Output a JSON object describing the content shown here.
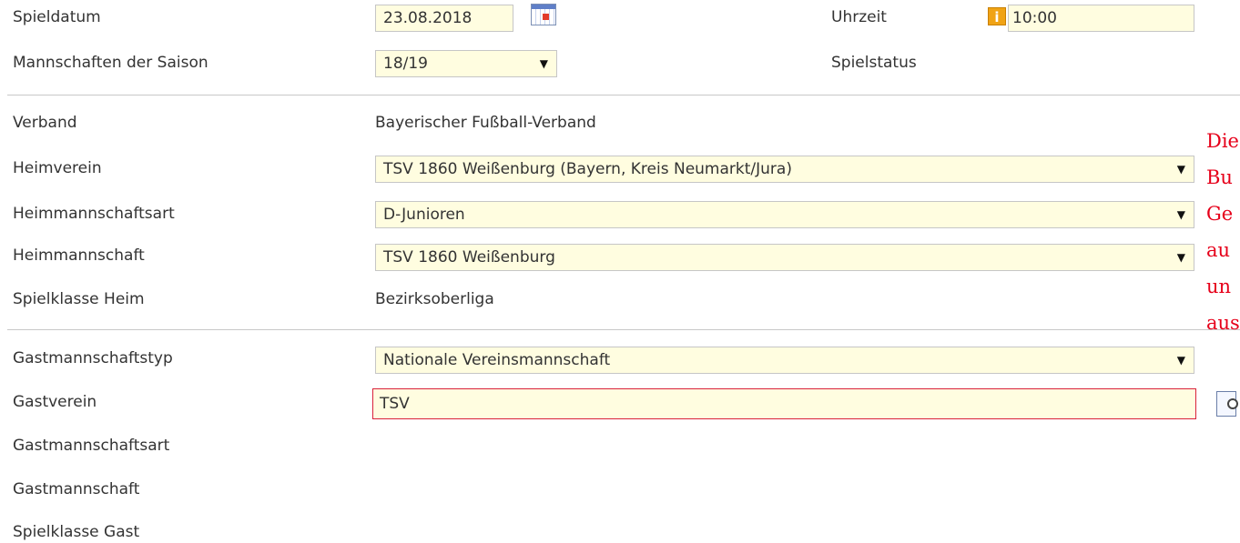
{
  "rows": {
    "spieldatum": {
      "label": "Spieldatum",
      "value": "23.08.2018"
    },
    "uhrzeit": {
      "label": "Uhrzeit",
      "value": "10:00",
      "info_glyph": "i"
    },
    "saison": {
      "label": "Mannschaften der Saison",
      "value": "18/19"
    },
    "spielstatus": {
      "label": "Spielstatus"
    },
    "verband": {
      "label": "Verband",
      "value": "Bayerischer Fußball-Verband"
    },
    "heimverein": {
      "label": "Heimverein",
      "value": "TSV 1860 Weißenburg (Bayern, Kreis Neumarkt/Jura)"
    },
    "heimmannschaftsart": {
      "label": "Heimmannschaftsart",
      "value": "D-Junioren"
    },
    "heimmannschaft": {
      "label": "Heimmannschaft",
      "value": "TSV 1860 Weißenburg"
    },
    "spielklasse_heim": {
      "label": "Spielklasse Heim",
      "value": "Bezirksoberliga"
    },
    "gastmannschaftstyp": {
      "label": "Gastmannschaftstyp",
      "value": "Nationale Vereinsmannschaft"
    },
    "gastverein": {
      "label": "Gastverein",
      "value": "TSV"
    },
    "gastmannschaftsart": {
      "label": "Gastmannschaftsart"
    },
    "gastmannschaft": {
      "label": "Gastmannschaft"
    },
    "spielklasse_gast": {
      "label": "Spielklasse Gast"
    }
  },
  "dropdown_arrow": "▼",
  "side_note_fragments": [
    "Die",
    "Bu",
    "Ge",
    "au",
    "un",
    "aus"
  ],
  "icons": {
    "calendar": "calendar-icon",
    "info": "info-icon",
    "search": "search-icon",
    "dropdown": "chevron-down-icon"
  },
  "colors": {
    "field_background": "#fffde0",
    "error_border": "#d9213a",
    "side_note": "#e6001a",
    "info_icon": "#f0a315"
  }
}
